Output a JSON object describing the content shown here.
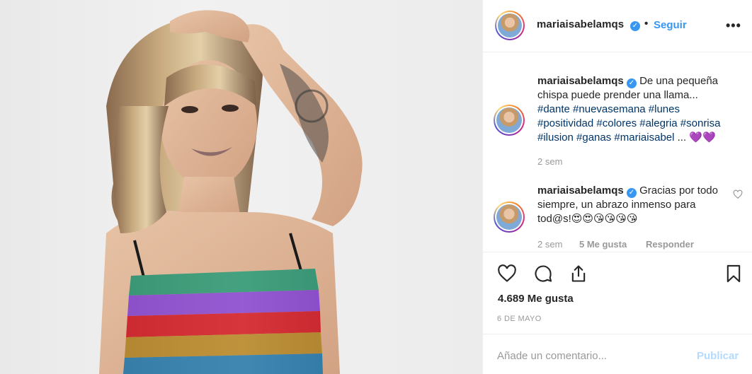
{
  "photo": {
    "alt": ""
  },
  "header": {
    "username": "mariaisabelamqs",
    "separator": "•",
    "follow_label": "Seguir",
    "more_label": "•••"
  },
  "caption": {
    "username": "mariaisabelamqs",
    "text": "De una pequeña chispa puede prender una llama...",
    "hashtags": "#dante #nuevasemana #lunes #positividad #colores #alegria #sonrisa #ilusion #ganas #mariaisabel",
    "ellipsis": " ...",
    "emojis": "💜💜",
    "time": "2 sem"
  },
  "comment": {
    "username": "mariaisabelamqs",
    "text": "Gracias por todo siempre, un abrazo inmenso para tod@s!",
    "emojis": "😍😍😘😘😘😘",
    "time": "2 sem",
    "likes": "5 Me gusta",
    "reply_label": "Responder"
  },
  "post": {
    "likes": "4.689 Me gusta",
    "date": "6 DE MAYO"
  },
  "comment_box": {
    "placeholder": "Añade un comentario...",
    "publish_label": "Publicar"
  },
  "colors": {
    "accent": "#3897f0",
    "publish_disabled": "#b3dbff",
    "hashtag": "#003569"
  }
}
